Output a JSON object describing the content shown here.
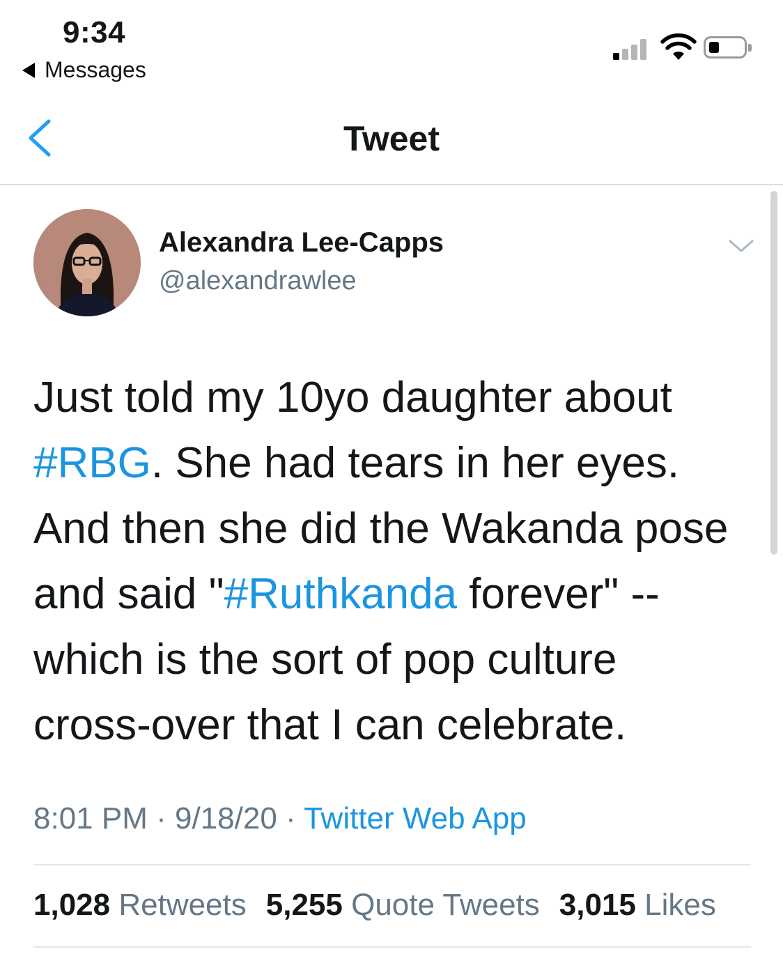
{
  "status_bar": {
    "time": "9:34",
    "back_app": "Messages"
  },
  "nav": {
    "title": "Tweet"
  },
  "tweet": {
    "author_name": "Alexandra Lee-Capps",
    "author_handle": "@alexandrawlee",
    "lines": [
      {
        "parts": [
          {
            "text": "Just told my 10yo daughter about"
          }
        ]
      },
      {
        "parts": [
          {
            "text": "#RBG",
            "link": true
          },
          {
            "text": ". She had tears in her eyes."
          }
        ]
      },
      {
        "parts": [
          {
            "text": "And then she did the Wakanda pose"
          }
        ]
      },
      {
        "parts": [
          {
            "text": "and said \""
          },
          {
            "text": "#Ruthkanda",
            "link": true
          },
          {
            "text": " forever\" --"
          }
        ]
      },
      {
        "parts": [
          {
            "text": "which is the sort of pop culture"
          }
        ]
      },
      {
        "parts": [
          {
            "text": "cross-over that I can celebrate."
          }
        ]
      }
    ],
    "time": "8:01 PM",
    "sep1": " · ",
    "date": "9/18/20",
    "sep2": " · ",
    "source": "Twitter Web App"
  },
  "stats": {
    "retweets_count": "1,028",
    "retweets_label": "Retweets",
    "quotes_count": "5,255",
    "quotes_label": "Quote Tweets",
    "likes_count": "3,015",
    "likes_label": "Likes"
  },
  "colors": {
    "link": "#1b95e0",
    "secondary_text": "#657786",
    "primary_text": "#14171a"
  },
  "icons": {
    "nav_back": "chevron-left-icon",
    "more": "chevron-down-icon",
    "signal": "cellular-signal-icon",
    "wifi": "wifi-icon",
    "battery": "battery-icon"
  }
}
